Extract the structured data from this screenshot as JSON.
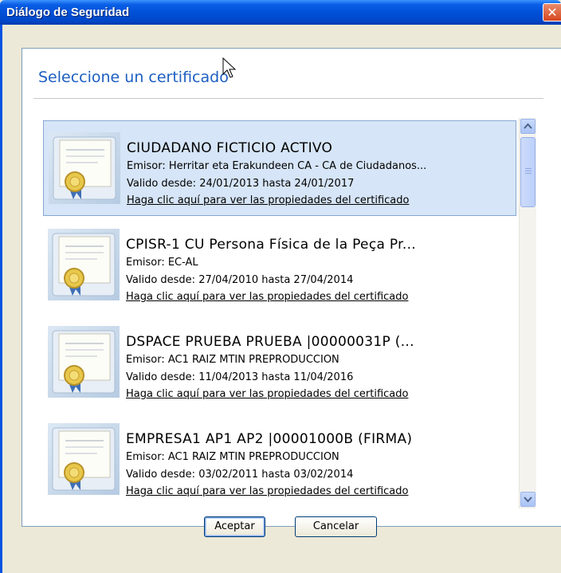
{
  "window": {
    "title": "Diálogo de Seguridad",
    "close_glyph": "✕"
  },
  "panel": {
    "heading": "Seleccione un certificado"
  },
  "certificates": [
    {
      "name": "CIUDADANO FICTICIO ACTIVO",
      "issuer": "Emisor: Herritar eta Erakundeen CA - CA de Ciudadanos...",
      "validity": "Valido desde: 24/01/2013 hasta 24/01/2017",
      "link": "Haga clic aquí para ver las propiedades del certificado",
      "selected": true,
      "icon": "certificate-icon"
    },
    {
      "name": "CPISR-1 CU Persona Física de la Peça Pr...",
      "issuer": "Emisor: EC-AL",
      "validity": "Valido desde: 27/04/2010 hasta 27/04/2014",
      "link": "Haga clic aquí para ver las propiedades del certificado",
      "selected": false,
      "icon": "certificate-icon"
    },
    {
      "name": "DSPACE PRUEBA PRUEBA |00000031P (...",
      "issuer": "Emisor: AC1 RAIZ MTIN PREPRODUCCION",
      "validity": "Valido desde: 11/04/2013 hasta 11/04/2016",
      "link": "Haga clic aquí para ver las propiedades del certificado",
      "selected": false,
      "icon": "certificate-icon"
    },
    {
      "name": "EMPRESA1 AP1 AP2 |00001000B (FIRMA)",
      "issuer": "Emisor: AC1 RAIZ MTIN PREPRODUCCION",
      "validity": "Valido desde: 03/02/2011 hasta 03/02/2014",
      "link": "Haga clic aquí para ver las propiedades del certificado",
      "selected": false,
      "icon": "certificate-icon"
    }
  ],
  "buttons": {
    "ok": "Aceptar",
    "cancel": "Cancelar"
  },
  "colors": {
    "title_bar": "#0051d8",
    "heading": "#1c5fc1",
    "selection": "#d6e5f7",
    "selection_border": "#86a7d2",
    "dialog_bg": "#ece9d8"
  }
}
